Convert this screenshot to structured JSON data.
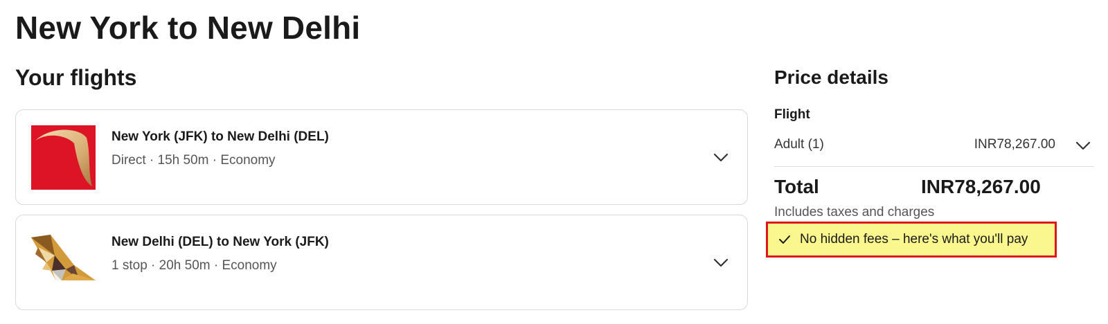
{
  "page": {
    "title": "New York to New Delhi"
  },
  "flights_section": {
    "title": "Your flights",
    "items": [
      {
        "route": "New York (JFK) to New Delhi (DEL)",
        "details": "Direct · 15h 50m · Economy",
        "logo": "airline-logo-red-icon"
      },
      {
        "route": "New Delhi (DEL) to New York (JFK)",
        "details": "1 stop · 20h 50m · Economy",
        "logo": "airline-tail-logo-icon"
      }
    ]
  },
  "price_details": {
    "title": "Price details",
    "flight_label": "Flight",
    "adult_label": "Adult (1)",
    "adult_price": "INR78,267.00",
    "total_label": "Total",
    "total_value": "INR78,267.00",
    "taxes_note": "Includes taxes and charges",
    "fees_banner": "No hidden fees – here's what you'll pay"
  },
  "colors": {
    "highlight_fill": "#fbf78f",
    "highlight_border": "#e0151c",
    "logo_red": "#dd1426"
  }
}
